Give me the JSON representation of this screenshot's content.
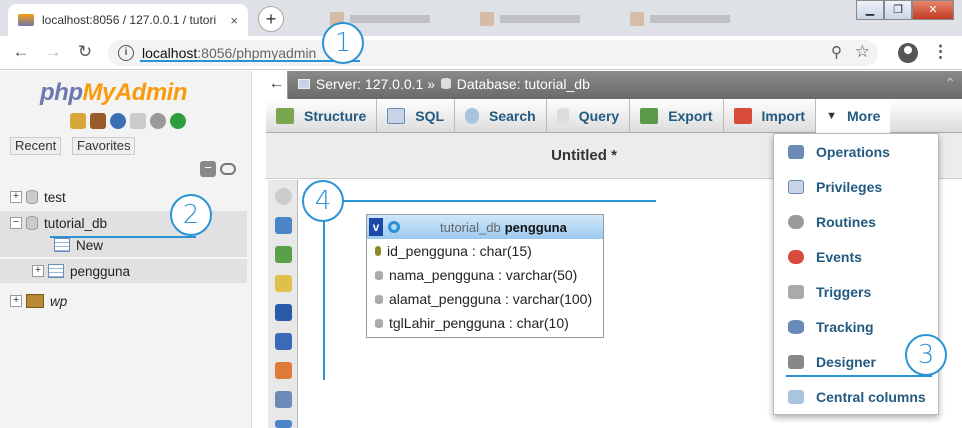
{
  "browser": {
    "tab_title": "localhost:8056 / 127.0.0.1 / tutori",
    "tab_close": "×",
    "new_tab": "+",
    "url_host": "localhost",
    "url_rest": ":8056/phpmyadmin",
    "window_controls": [
      "▁",
      "❐",
      "✕"
    ]
  },
  "sidebar": {
    "logo_php": "php",
    "logo_myadmin": "MyAdmin",
    "recent": "Recent",
    "favorites": "Favorites",
    "collapse": "−",
    "tree": [
      {
        "label": "test"
      },
      {
        "label": "tutorial_db"
      },
      {
        "label": "New"
      },
      {
        "label": "pengguna"
      },
      {
        "label": "wp"
      }
    ]
  },
  "breadcrumb": {
    "server": "Server: 127.0.0.1",
    "sep": "»",
    "database": "Database: tutorial_db"
  },
  "menu": {
    "structure": "Structure",
    "sql": "SQL",
    "search": "Search",
    "query": "Query",
    "export": "Export",
    "import": "Import",
    "more": "More"
  },
  "designer": {
    "title": "Untitled *",
    "table_db": "tutorial_db",
    "table_name": "pengguna",
    "columns": [
      "id_pengguna : char(15)",
      "nama_pengguna : varchar(50)",
      "alamat_pengguna : varchar(100)",
      "tglLahir_pengguna : char(10)"
    ]
  },
  "more_menu": [
    "Operations",
    "Privileges",
    "Routines",
    "Events",
    "Triggers",
    "Tracking",
    "Designer",
    "Central columns"
  ],
  "annotations": [
    "1",
    "2",
    "3",
    "4"
  ],
  "colors": {
    "annotation": "#2a93d5",
    "link": "#235a81",
    "logo_php": "#6c78af",
    "logo_myadmin": "#f89c0e"
  }
}
